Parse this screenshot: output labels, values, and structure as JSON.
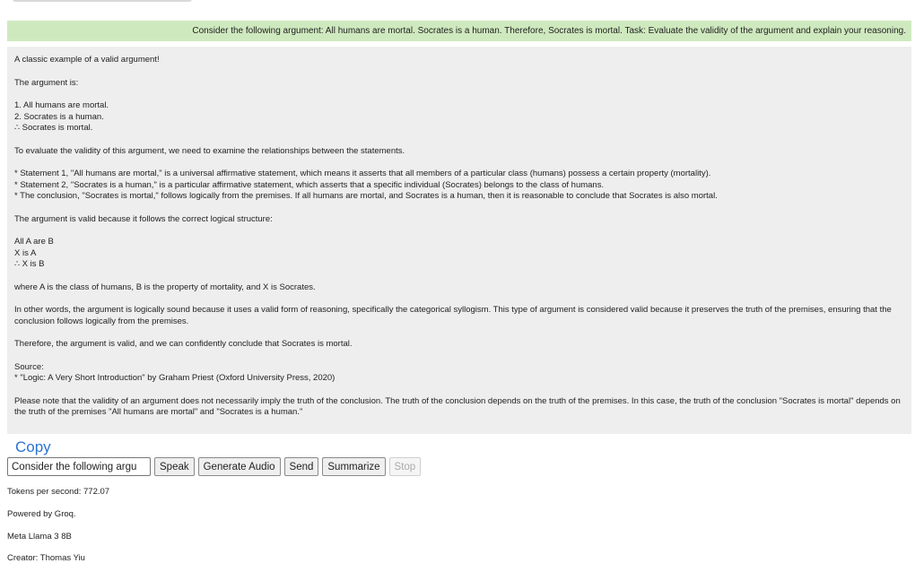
{
  "user_message": "Consider the following argument:  All humans are mortal. Socrates is a human. Therefore, Socrates is mortal. Task: Evaluate the validity of the argument and explain your reasoning.",
  "response": {
    "intro": "A classic example of a valid argument!",
    "argument_heading": "The argument is:",
    "argument_lines": [
      "1. All humans are mortal.",
      "2. Socrates is a human.",
      "∴ Socrates is mortal."
    ],
    "evaluate": "To evaluate the validity of this argument, we need to examine the relationships between the statements.",
    "statements": [
      "* Statement 1, \"All humans are mortal,\" is a universal affirmative statement, which means it asserts that all members of a particular class (humans) possess a certain property (mortality).",
      "* Statement 2, \"Socrates is a human,\" is a particular affirmative statement, which asserts that a specific individual (Socrates) belongs to the class of humans.",
      "* The conclusion, \"Socrates is mortal,\" follows logically from the premises. If all humans are mortal, and Socrates is a human, then it is reasonable to conclude that Socrates is also mortal."
    ],
    "structure_intro": "The argument is valid because it follows the correct logical structure:",
    "structure_lines": [
      "All A are B",
      "X is A",
      "∴ X is B"
    ],
    "where": "where A is the class of humans, B is the property of mortality, and X is Socrates.",
    "other_words": "In other words, the argument is logically sound because it uses a valid form of reasoning, specifically the categorical syllogism. This type of argument is considered valid because it preserves the truth of the premises, ensuring that the conclusion follows logically from the premises.",
    "therefore": "Therefore, the argument is valid, and we can confidently conclude that Socrates is mortal.",
    "source_label": "Source:",
    "source_ref": "* \"Logic: A Very Short Introduction\" by Graham Priest (Oxford University Press, 2020)",
    "note": "Please note that the validity of an argument does not necessarily imply the truth of the conclusion. The truth of the conclusion depends on the truth of the premises. In this case, the truth of the conclusion \"Socrates is mortal\" depends on the truth of the premises \"All humans are mortal\" and \"Socrates is a human.\""
  },
  "copy_label": "Copy",
  "input_value": "Consider the following argu",
  "buttons": {
    "speak": "Speak",
    "generate_audio": "Generate Audio",
    "send": "Send",
    "summarize": "Summarize",
    "stop": "Stop"
  },
  "info": {
    "tokens": "Tokens per second: 772.07",
    "powered": "Powered by Groq.",
    "model": "Meta Llama 3 8B",
    "creator": "Creator: Thomas Yiu"
  }
}
